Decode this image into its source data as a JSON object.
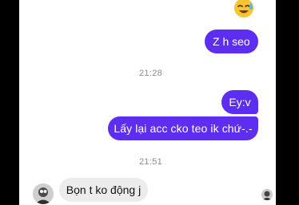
{
  "messages": {
    "out_1": "Z h seo",
    "time_1": "21:28",
    "out_2": "Ey:v",
    "out_3": "Lấy lại acc cko teo ik chứ-.-",
    "time_2": "21:51",
    "in_1": "Bọn t ko động j"
  },
  "icons": {
    "reaction": "sweat-smile-emoji",
    "contact": "contact-avatar",
    "seen": "seen-receipt-avatar"
  },
  "colors": {
    "outgoing_bubble": "#5d2ef2",
    "incoming_bubble": "#ececec",
    "timestamp": "#8e8e8e"
  }
}
